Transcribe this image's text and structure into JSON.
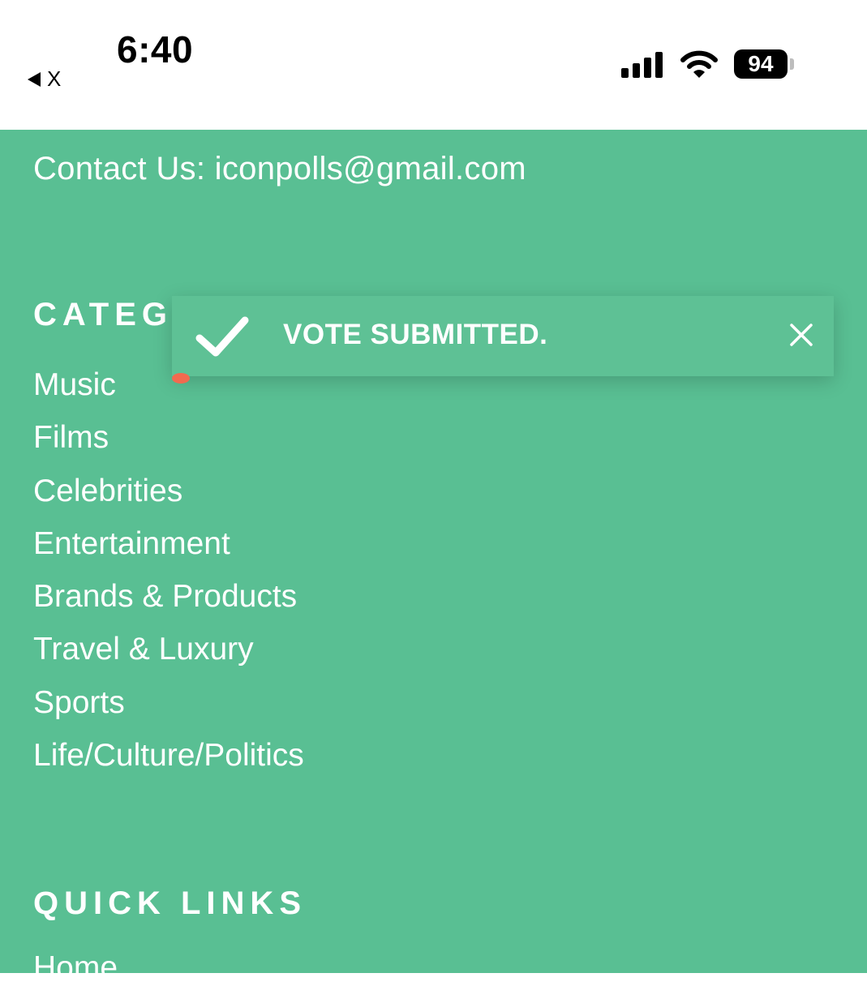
{
  "status_bar": {
    "time": "6:40",
    "back_app": "X",
    "battery_level": "94",
    "icons": [
      "signal-icon",
      "wifi-icon",
      "battery-icon"
    ]
  },
  "footer": {
    "contact": "Contact Us: iconpolls@gmail.com",
    "categories_heading": "CATEG",
    "categories": [
      "Music",
      "Films",
      "Celebrities",
      "Entertainment",
      "Brands & Products",
      "Travel & Luxury",
      "Sports",
      "Life/Culture/Politics"
    ],
    "quick_links_heading": "QUICK LINKS",
    "quick_links": [
      "Home"
    ]
  },
  "toast": {
    "message": "VOTE SUBMITTED.",
    "icon": "check-icon",
    "close_icon": "close-icon"
  },
  "colors": {
    "footer_bg": "#59bf93",
    "toast_bg": "#5ec195",
    "text": "#ffffff",
    "accent_dot": "#f26a4f"
  }
}
